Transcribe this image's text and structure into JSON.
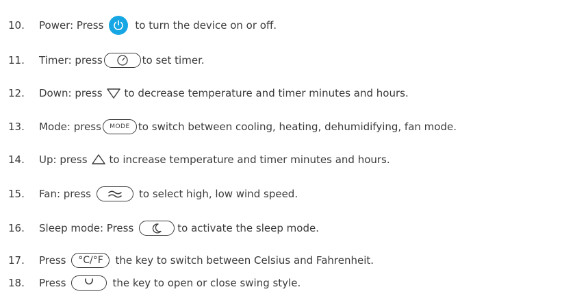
{
  "colors": {
    "text": "#3a3a3a",
    "power_accent": "#16a6e3"
  },
  "items": [
    {
      "num": "10.",
      "before": "Power: Press",
      "icon": "power-icon",
      "after": "to turn the device on or off."
    },
    {
      "num": "11.",
      "before": "Timer: press",
      "icon": "timer-icon",
      "after": "to set timer."
    },
    {
      "num": "12.",
      "before": "Down: press",
      "icon": "triangle-down-icon",
      "after": "to decrease temperature and timer minutes and hours."
    },
    {
      "num": "13.",
      "before": "Mode: press",
      "icon": "mode-key",
      "key_label": "MODE",
      "after": "to switch between cooling, heating, dehumidifying, fan mode."
    },
    {
      "num": "14.",
      "before": "Up: press",
      "icon": "triangle-up-icon",
      "after": "to increase temperature and timer minutes and hours."
    },
    {
      "num": "15.",
      "before": "Fan: press",
      "icon": "fan-speed-icon",
      "after": "to select high, low wind speed."
    },
    {
      "num": "16.",
      "before": "Sleep mode: Press",
      "icon": "moon-icon",
      "after": "to activate the sleep mode."
    },
    {
      "num": "17.",
      "before": "Press",
      "icon": "celsius-fahrenheit-key",
      "key_label": "°C/°F",
      "after": "the key  to switch between Celsius and Fahrenheit."
    },
    {
      "num": "18.",
      "before": "Press",
      "icon": "swing-icon",
      "after": "the key to open or close swing style."
    }
  ]
}
